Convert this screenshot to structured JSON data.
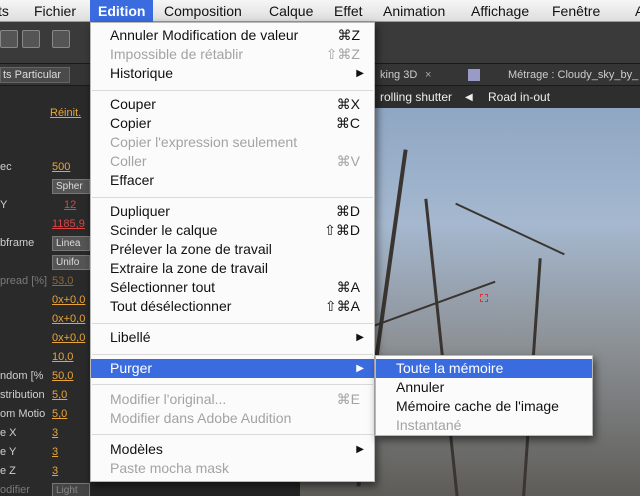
{
  "menubar": {
    "items": [
      "ts",
      "Fichier",
      "Edition",
      "Composition",
      "Calque",
      "Effet",
      "Animation",
      "Affichage",
      "Fenêtre",
      "Aid"
    ]
  },
  "tabs": {
    "layer_select": "ts Particular",
    "comp_tab": "king 3D",
    "close": "×",
    "footage_tab": "Métrage : Cloudy_sky_by_"
  },
  "subheader": {
    "effect_title": "rticular",
    "rolling_shutter": "rolling shutter",
    "road_inout": "Road in-out"
  },
  "effects_panel": {
    "reinit": "Réinit.",
    "rows": [
      {
        "label": "ec",
        "value": "500"
      },
      {
        "label": "",
        "box": "Spher"
      },
      {
        "label": "Y",
        "value": "12"
      },
      {
        "label": "",
        "value": "1185,9"
      },
      {
        "label": "bframe",
        "box": "Linea"
      },
      {
        "label": "",
        "box": "Unifo"
      },
      {
        "label": "pread [%]",
        "value": "53,0"
      },
      {
        "label": "",
        "value": "0x+0,0"
      },
      {
        "label": "",
        "value": "0x+0,0"
      },
      {
        "label": "",
        "value": "0x+0,0"
      },
      {
        "label": "",
        "value": "10,0"
      },
      {
        "label": "ndom [%",
        "value": "50,0"
      },
      {
        "label": "stribution",
        "value": "5,0"
      },
      {
        "label": "om Motio",
        "value": "5,0"
      },
      {
        "label": "e X",
        "value": "3"
      },
      {
        "label": "e Y",
        "value": "3"
      },
      {
        "label": "e Z",
        "value": "3"
      },
      {
        "label": "odifier",
        "box": "Light"
      }
    ]
  },
  "edit_menu": {
    "items": [
      {
        "label": "Annuler Modification de valeur",
        "shortcut": "⌘Z"
      },
      {
        "label": "Impossible de rétablir",
        "shortcut": "⇧⌘Z"
      },
      {
        "label": "Historique",
        "arrow": "▶"
      },
      {
        "label": "Couper",
        "shortcut": "⌘X"
      },
      {
        "label": "Copier",
        "shortcut": "⌘C"
      },
      {
        "label": "Copier l'expression seulement",
        "shortcut": ""
      },
      {
        "label": "Coller",
        "shortcut": "⌘V"
      },
      {
        "label": "Effacer",
        "shortcut": ""
      },
      {
        "label": "Dupliquer",
        "shortcut": "⌘D"
      },
      {
        "label": "Scinder le calque",
        "shortcut": "⇧⌘D"
      },
      {
        "label": "Prélever la zone de travail",
        "shortcut": ""
      },
      {
        "label": "Extraire la zone de travail",
        "shortcut": ""
      },
      {
        "label": "Sélectionner tout",
        "shortcut": "⌘A"
      },
      {
        "label": "Tout désélectionner",
        "shortcut": "⇧⌘A"
      },
      {
        "label": "Libellé",
        "arrow": "▶"
      },
      {
        "label": "Purger",
        "arrow": "▶"
      },
      {
        "label": "Modifier l'original...",
        "shortcut": "⌘E"
      },
      {
        "label": "Modifier dans Adobe Audition",
        "shortcut": ""
      },
      {
        "label": "Modèles",
        "arrow": "▶"
      },
      {
        "label": "Paste mocha mask",
        "shortcut": ""
      }
    ]
  },
  "purge_submenu": {
    "items": [
      {
        "label": "Toute la mémoire"
      },
      {
        "label": "Annuler"
      },
      {
        "label": "Mémoire cache de l'image"
      },
      {
        "label": "Instantané"
      }
    ]
  },
  "colors": {
    "highlight": "#3a6ce0",
    "value_orange": "#e9a53a",
    "disabled_text": "#a3a3a3"
  }
}
